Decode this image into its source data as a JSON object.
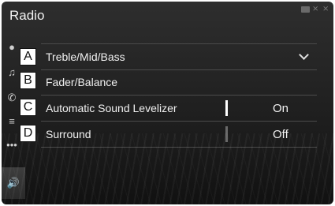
{
  "title": "Radio",
  "items": [
    {
      "callout": "A",
      "label": "Treble/Mid/Bass",
      "expandable": true
    },
    {
      "callout": "B",
      "label": "Fader/Balance"
    },
    {
      "callout": "C",
      "label": "Automatic Sound Levelizer",
      "value": "On",
      "state": "on"
    },
    {
      "callout": "D",
      "label": "Surround",
      "value": "Off",
      "state": "off"
    }
  ],
  "sidebar": {
    "icons": [
      "radio-source-icon",
      "media-source-icon",
      "phone-source-icon",
      "list-icon",
      "more-icon",
      "speaker-icon"
    ],
    "more_label": "•••"
  },
  "colors": {
    "background": "#222222",
    "text": "#f0f0f0",
    "divider": "#4b4b4b"
  }
}
